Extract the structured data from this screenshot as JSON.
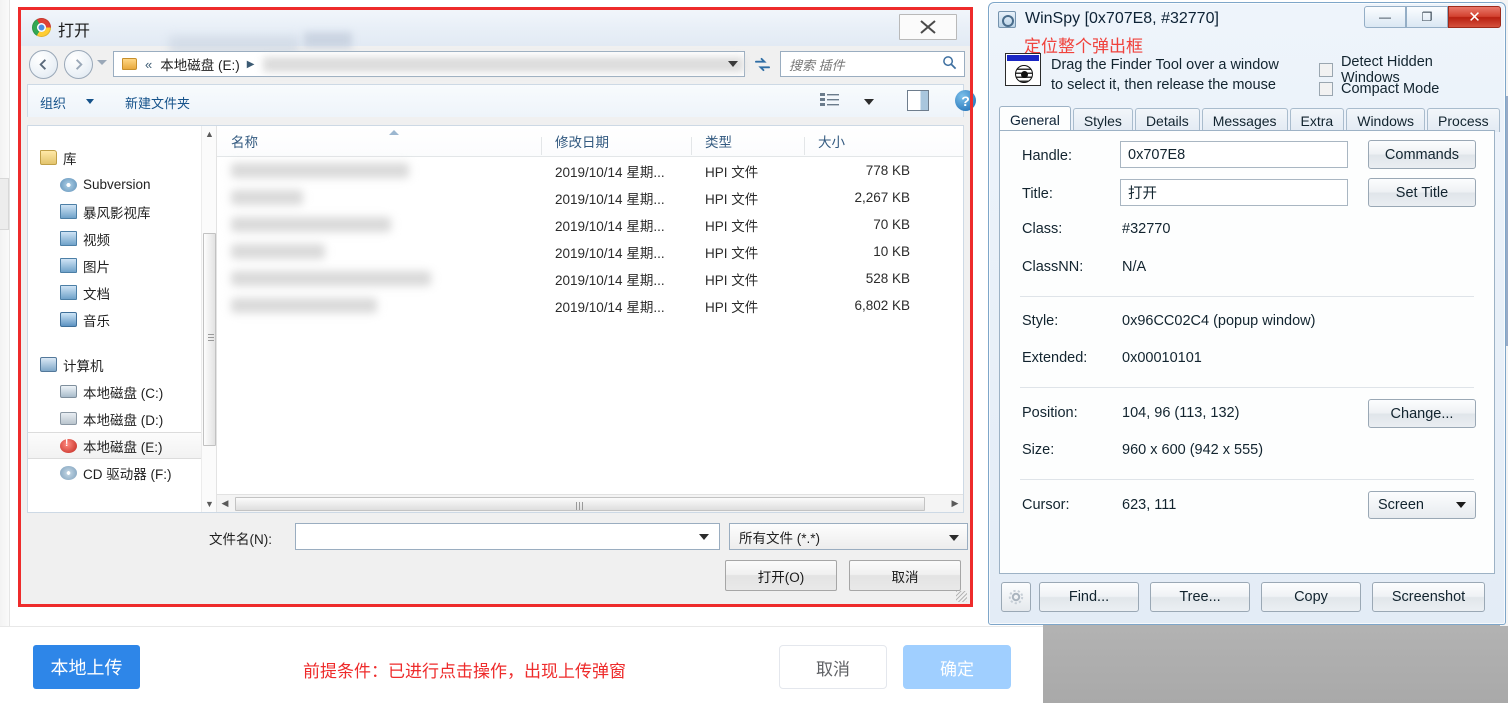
{
  "open_dialog": {
    "title": "打开",
    "close_label": "✕",
    "nav": {
      "back_icon": "back-arrow-icon",
      "forward_icon": "forward-arrow-icon",
      "history_dropdown_icon": "chevron-down-icon",
      "address_chevrons": "«",
      "address_segment": "本地磁盘 (E:)",
      "address_separator": "▶",
      "refresh_icon": "refresh-icon",
      "search_placeholder": "搜索 插件",
      "search_icon": "search-icon"
    },
    "toolbar": {
      "organize": "组织",
      "organize_caret_icon": "chevron-down-icon",
      "new_folder": "新建文件夹",
      "view_icon": "list-view-icon",
      "view_caret_icon": "chevron-down-icon",
      "preview_pane_icon": "preview-pane-icon",
      "help_icon": "help-icon",
      "help_glyph": "?"
    },
    "tree": {
      "groups": [
        {
          "label": "库",
          "icon": "library-icon",
          "items": [
            {
              "label": "Subversion",
              "icon": "subversion-icon"
            },
            {
              "label": "暴风影视库",
              "icon": "video-library-icon"
            },
            {
              "label": "视频",
              "icon": "videos-icon"
            },
            {
              "label": "图片",
              "icon": "pictures-icon"
            },
            {
              "label": "文档",
              "icon": "documents-icon"
            },
            {
              "label": "音乐",
              "icon": "music-icon"
            }
          ]
        },
        {
          "label": "计算机",
          "icon": "computer-icon",
          "items": [
            {
              "label": "本地磁盘 (C:)",
              "icon": "drive-c-icon",
              "selected": false
            },
            {
              "label": "本地磁盘 (D:)",
              "icon": "drive-d-icon",
              "selected": false
            },
            {
              "label": "本地磁盘 (E:)",
              "icon": "drive-e-icon",
              "selected": true
            },
            {
              "label": "CD 驱动器 (F:)",
              "icon": "cd-drive-icon",
              "selected": false
            }
          ]
        }
      ]
    },
    "file_list": {
      "columns": [
        "名称",
        "修改日期",
        "类型",
        "大小"
      ],
      "sort_indicator_icon": "sort-ascending-icon",
      "rows": [
        {
          "name": "",
          "date": "2019/10/14 星期...",
          "type": "HPI 文件",
          "size": "778 KB",
          "blur_width": 178
        },
        {
          "name": "",
          "date": "2019/10/14 星期...",
          "type": "HPI 文件",
          "size": "2,267 KB",
          "blur_width": 72
        },
        {
          "name": "",
          "date": "2019/10/14 星期...",
          "type": "HPI 文件",
          "size": "70 KB",
          "blur_width": 160
        },
        {
          "name": "",
          "date": "2019/10/14 星期...",
          "type": "HPI 文件",
          "size": "10 KB",
          "blur_width": 94
        },
        {
          "name": "",
          "date": "2019/10/14 星期...",
          "type": "HPI 文件",
          "size": "528 KB",
          "blur_width": 200
        },
        {
          "name": "",
          "date": "2019/10/14 星期...",
          "type": "HPI 文件",
          "size": "6,802 KB",
          "blur_width": 146
        }
      ]
    },
    "footer": {
      "filename_label": "文件名(N):",
      "filename_value": "",
      "filename_dropdown_icon": "chevron-down-icon",
      "filetype_value": "所有文件 (*.*)",
      "filetype_dropdown_icon": "chevron-down-icon",
      "open_button": "打开(O)",
      "cancel_button": "取消"
    }
  },
  "winspy": {
    "title": "WinSpy [0x707E8, #32770]",
    "window_buttons": {
      "minimize": "—",
      "maximize": "❐",
      "close": "✕"
    },
    "red_note": "定位整个弹出框",
    "finder_icon": "finder-tool-icon",
    "hint_line1": "Drag the Finder Tool over a window",
    "hint_line2": "to select it, then release the mouse",
    "checkboxes": [
      {
        "label": "Detect Hidden Windows",
        "checked": false
      },
      {
        "label": "Compact Mode",
        "checked": false
      }
    ],
    "tabs": [
      {
        "label": "General",
        "active": true
      },
      {
        "label": "Styles",
        "active": false
      },
      {
        "label": "Details",
        "active": false
      },
      {
        "label": "Messages",
        "active": false
      },
      {
        "label": "Extra",
        "active": false
      },
      {
        "label": "Windows",
        "active": false
      },
      {
        "label": "Process",
        "active": false
      }
    ],
    "general": {
      "handle_label": "Handle:",
      "handle_value": "0x707E8",
      "commands_button": "Commands",
      "title_label": "Title:",
      "title_value": "打开",
      "set_title_button": "Set Title",
      "class_label": "Class:",
      "class_value": "#32770",
      "classnn_label": "ClassNN:",
      "classnn_value": "N/A",
      "style_label": "Style:",
      "style_value": "0x96CC02C4 (popup window)",
      "extended_label": "Extended:",
      "extended_value": "0x00010101",
      "position_label": "Position:",
      "position_value": "104, 96 (113, 132)",
      "change_button": "Change...",
      "size_label": "Size:",
      "size_value": "960 x 600 (942 x 555)",
      "cursor_label": "Cursor:",
      "cursor_value": "623, 111",
      "cursor_mode": "Screen",
      "cursor_mode_dropdown_icon": "chevron-down-icon"
    },
    "footer": {
      "settings_icon": "gear-icon",
      "find_button": "Find...",
      "tree_button": "Tree...",
      "copy_button": "Copy",
      "screenshot_button": "Screenshot"
    }
  },
  "web_page": {
    "upload_button": "本地上传",
    "cancel_button": "取消",
    "confirm_button": "确定",
    "annotation": "前提条件：已进行点击操作，出现上传弹窗"
  },
  "colors": {
    "annotation_red": "#ee2b2b",
    "upload_blue": "#2e86e8",
    "confirm_blue": "#a0cfff",
    "winspy_close_red": "#d2412f",
    "link_blue": "#15528a"
  }
}
